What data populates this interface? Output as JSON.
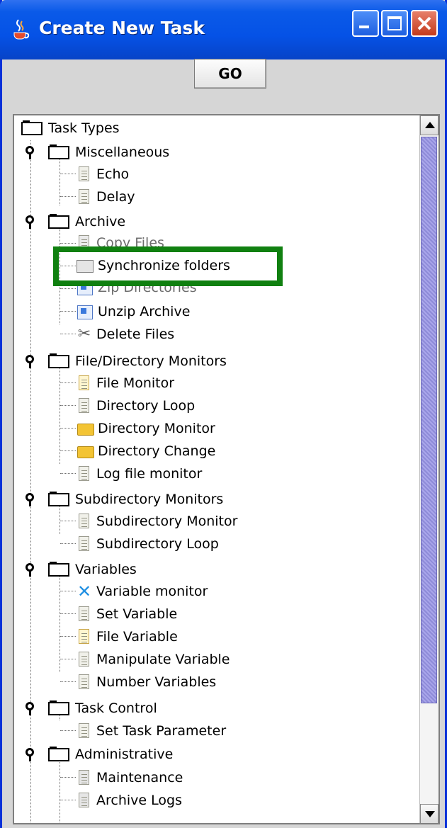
{
  "window": {
    "title": "Create New Task",
    "controls": [
      "minimize",
      "maximize",
      "close"
    ]
  },
  "toolbar": {
    "go_label": "GO"
  },
  "tree": {
    "root_label": "Task Types",
    "groups": [
      {
        "label": "Miscellaneous",
        "items": [
          {
            "label": "Echo",
            "icon": "document-icon"
          },
          {
            "label": "Delay",
            "icon": "document-icon"
          }
        ]
      },
      {
        "label": "Archive",
        "items": [
          {
            "label": "Copy Files",
            "icon": "copy-files-icon"
          },
          {
            "label": "Synchronize folders",
            "icon": "sync-folders-icon"
          },
          {
            "label": "Zip Directories",
            "icon": "zip-icon"
          },
          {
            "label": "Unzip Archive",
            "icon": "unzip-icon"
          },
          {
            "label": "Delete Files",
            "icon": "scissors-icon"
          }
        ]
      },
      {
        "label": "File/Directory Monitors",
        "items": [
          {
            "label": "File Monitor",
            "icon": "pencil-icon"
          },
          {
            "label": "Directory Loop",
            "icon": "document-icon"
          },
          {
            "label": "Directory Monitor",
            "icon": "folder-open-icon"
          },
          {
            "label": "Directory Change",
            "icon": "folder-open-icon"
          },
          {
            "label": "Log file monitor",
            "icon": "document-icon"
          }
        ]
      },
      {
        "label": "Subdirectory Monitors",
        "items": [
          {
            "label": "Subdirectory Monitor",
            "icon": "document-icon"
          },
          {
            "label": "Subdirectory Loop",
            "icon": "document-icon"
          }
        ]
      },
      {
        "label": "Variables",
        "items": [
          {
            "label": "Variable monitor",
            "icon": "x-icon"
          },
          {
            "label": "Set Variable",
            "icon": "document-icon"
          },
          {
            "label": "File Variable",
            "icon": "pencil-icon"
          },
          {
            "label": "Manipulate Variable",
            "icon": "document-icon"
          },
          {
            "label": "Number Variables",
            "icon": "document-icon"
          }
        ]
      },
      {
        "label": "Task Control",
        "items": [
          {
            "label": "Set Task Parameter",
            "icon": "document-icon"
          }
        ]
      },
      {
        "label": "Administrative",
        "items": [
          {
            "label": "Maintenance",
            "icon": "maintenance-icon"
          },
          {
            "label": "Archive Logs",
            "icon": "archive-logs-icon"
          }
        ]
      }
    ]
  },
  "highlight": {
    "color": "#108010",
    "target": "Synchronize folders"
  }
}
